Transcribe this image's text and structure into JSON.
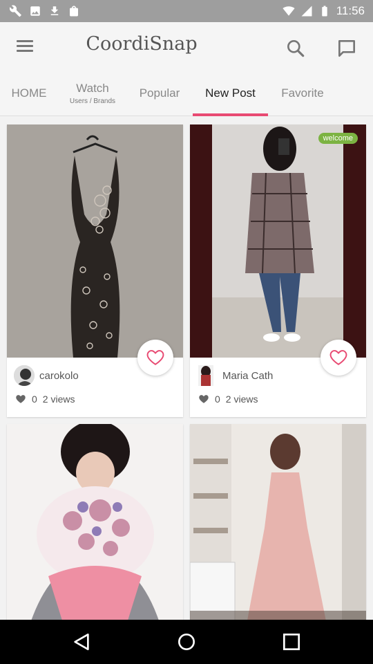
{
  "status": {
    "time": "11:56"
  },
  "app": {
    "title": "CoordiSnap"
  },
  "tabs": [
    {
      "label": "HOME",
      "sub": ""
    },
    {
      "label": "Watch",
      "sub": "Users / Brands"
    },
    {
      "label": "Popular",
      "sub": ""
    },
    {
      "label": "New Post",
      "sub": ""
    },
    {
      "label": "Favorite",
      "sub": ""
    }
  ],
  "posts": [
    {
      "user": "carokolo",
      "likes": "0",
      "views": "2 views",
      "badge": ""
    },
    {
      "user": "Maria Cath",
      "likes": "0",
      "views": "2 views",
      "badge": "welcome"
    },
    {
      "user": "",
      "likes": "",
      "views": "",
      "badge": ""
    },
    {
      "user": "",
      "likes": "",
      "views": "",
      "badge": ""
    }
  ],
  "colors": {
    "accent": "#e84a72",
    "badge": "#7cb342"
  }
}
